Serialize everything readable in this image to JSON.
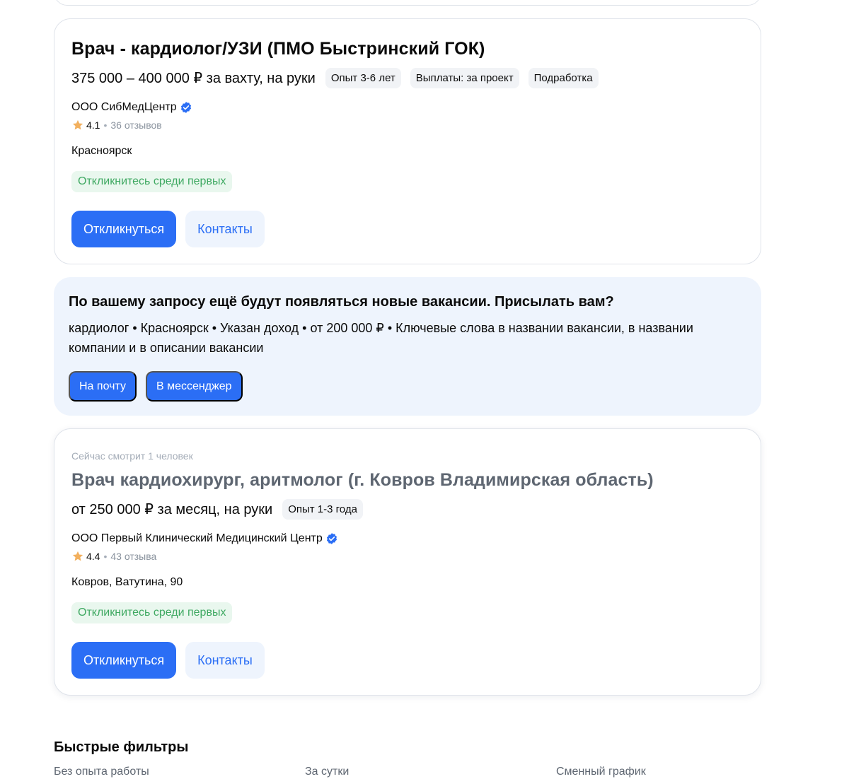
{
  "vacancies": [
    {
      "title": "Врач - кардиолог/УЗИ (ПМО Быстринский ГОК)",
      "salary": "375 000 – 400 000 ₽ за вахту, на руки",
      "tags": [
        "Опыт 3-6 лет",
        "Выплаты: за проект",
        "Подработка"
      ],
      "company": "ООО СибМедЦентр",
      "rating": "4.1",
      "reviews": "36 отзывов",
      "location": "Красноярск",
      "badge": "Откликнитесь среди первых",
      "apply_label": "Откликнуться",
      "contacts_label": "Контакты"
    },
    {
      "viewing": "Сейчас смотрит 1 человек",
      "title": "Врач кардиохирург, аритмолог (г. Ковров Владимирская область)",
      "salary": "от 250 000 ₽ за месяц, на руки",
      "tags": [
        "Опыт 1-3 года"
      ],
      "company": "ООО Первый Клинический Медицинский Центр",
      "rating": "4.4",
      "reviews": "43 отзыва",
      "location": "Ковров, Ватутина, 90",
      "badge": "Откликнитесь среди первых",
      "apply_label": "Откликнуться",
      "contacts_label": "Контакты"
    }
  ],
  "subscribe": {
    "title": "По вашему запросу ещё будут появляться новые вакансии. Присылать вам?",
    "text": "кардиолог • Красноярск • Указан доход • от 200 000 ₽ • Ключевые слова в названии вакансии, в названии компании и в описании вакансии",
    "email_label": "На почту",
    "messenger_label": "В мессенджер"
  },
  "quick_filters": {
    "title": "Быстрые фильтры",
    "items": [
      "Без опыта работы",
      "За сутки",
      "Сменный график"
    ]
  },
  "colors": {
    "accent": "#2b6ef5",
    "accent_light": "#eef4fd",
    "success": "#3fa962",
    "success_bg": "#e9f7ee",
    "star": "#f2b05e"
  },
  "icons": {
    "verified": "verified-check-icon",
    "star": "star-icon"
  }
}
